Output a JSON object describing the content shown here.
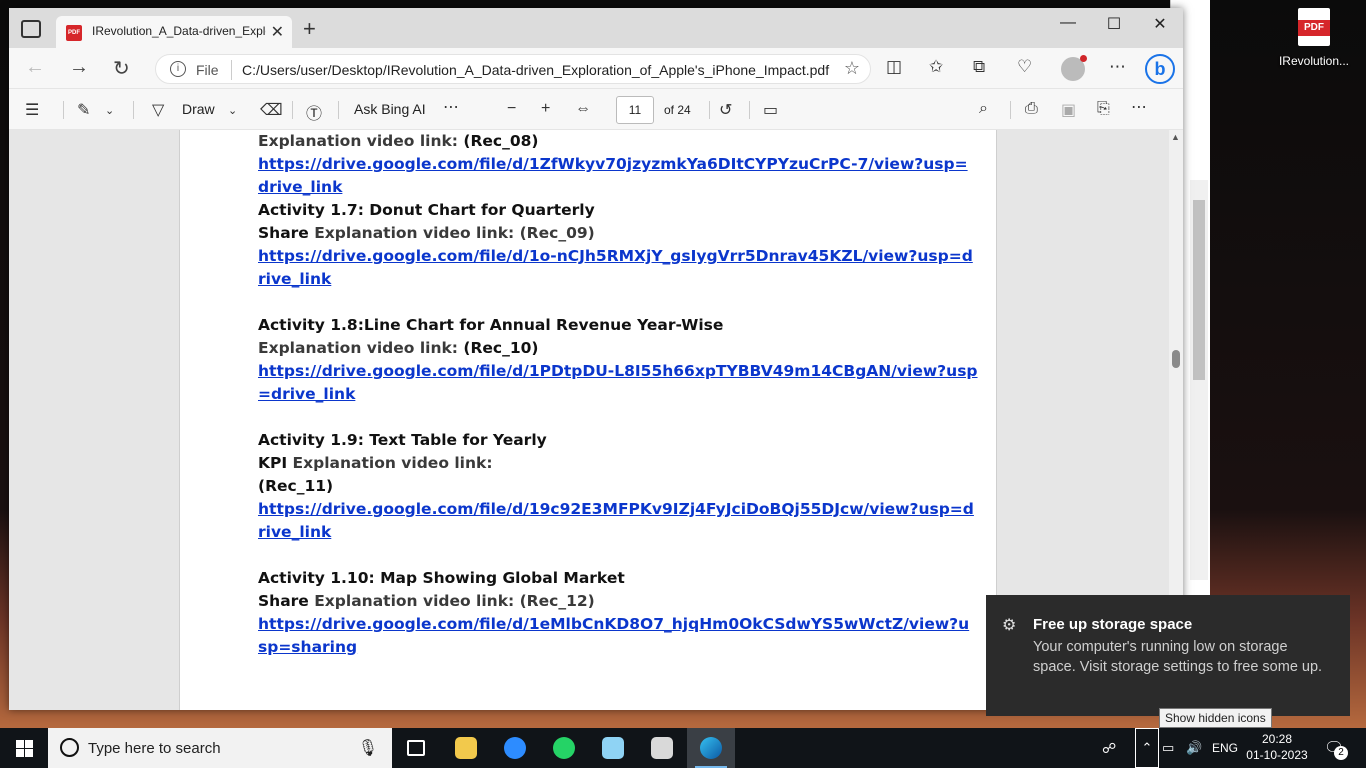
{
  "desktop": {
    "file_label": "IRevolution...",
    "file_tag": "PDF"
  },
  "browser": {
    "tab_title": "IRevolution_A_Data-driven_Explo",
    "tab_favicon": "PDF",
    "url_scheme": "File",
    "url_path": "C:/Users/user/Desktop/IRevolution_A_Data-driven_Exploration_of_Apple's_iPhone_Impact.pdf",
    "bing_label": "b"
  },
  "pdf_toolbar": {
    "draw_label": "Draw",
    "ask_bing_label": "Ask Bing AI",
    "page_current": "11",
    "page_total": "of 24"
  },
  "document": {
    "lines": [
      {
        "pre": "",
        "muted": "Explanation video link:",
        "post": " (Rec_08)"
      },
      {
        "link": "https://drive.google.com/file/d/1ZfWkyv70jzyzmkYa6DItCYPYzuCrPC-7/view?usp=drive_link"
      },
      {
        "heading": "Activity 1.7: Donut Chart for Quarterly"
      },
      {
        "pre": "Share ",
        "muted": "Explanation video link: (Rec_09)",
        "post": ""
      },
      {
        "link": "https://drive.google.com/file/d/1o-nCJh5RMXjY_gsIygVrr5Dnrav45KZL/view?usp=drive_link"
      },
      {
        "gap": true
      },
      {
        "heading": "Activity 1.8:Line Chart for Annual Revenue Year-Wise"
      },
      {
        "pre": "",
        "muted": "Explanation video link:",
        "post": " (Rec_10)"
      },
      {
        "link": "https://drive.google.com/file/d/1PDtpDU-L8I55h66xpTYBBV49m14CBgAN/view?usp=drive_link"
      },
      {
        "gap": true
      },
      {
        "heading": "Activity 1.9: Text Table for Yearly"
      },
      {
        "pre": "KPI ",
        "muted": "Explanation video link:",
        "post": ""
      },
      {
        "pre": "(Rec_11)",
        "muted": "",
        "post": ""
      },
      {
        "link": "https://drive.google.com/file/d/19c92E3MFPKv9IZj4FyJciDoBQj55DJcw/view?usp=drive_link"
      },
      {
        "gap": true
      },
      {
        "heading": "Activity 1.10: Map Showing Global Market"
      },
      {
        "pre": "Share ",
        "muted": "Explanation video link: (Rec_12)",
        "post": ""
      },
      {
        "link": "https://drive.google.com/file/d/1eMlbCnKD8O7_hjqHm0OkCSdwYS5wWctZ/view?usp=sharing"
      }
    ]
  },
  "toast": {
    "title": "Free up storage space",
    "body": "Your computer's running low on storage space. Visit storage settings to free some up."
  },
  "tooltip": "Show hidden icons",
  "taskbar": {
    "search_placeholder": "Type here to search",
    "language": "ENG",
    "time": "20:28",
    "date": "01-10-2023",
    "notification_count": "2"
  },
  "colors": {
    "link": "#0b36cc",
    "toast_bg": "#2b2b2b",
    "taskbar_bg": "#101418",
    "pdf_red": "#d6262a"
  }
}
